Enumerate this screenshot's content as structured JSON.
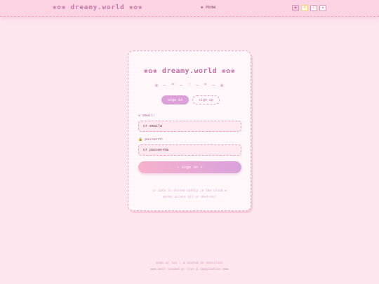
{
  "header": {
    "brand": "❀✿❀ dreamy.world ❀✿❀",
    "nav_home": "❀ Home",
    "theme_buttons": [
      "◆",
      "☀",
      "☾",
      "★"
    ]
  },
  "card": {
    "title": "❀✿❀ dreamy.world ❀✿❀",
    "divider": "❀ ~ * ~ ♡ ~ * ~ ❀",
    "tabs": {
      "signin": "sign in",
      "signup": "sign up"
    },
    "email_label": "✉ email:",
    "email_placeholder": "ur email✿",
    "password_label": "🔒 password:",
    "password_placeholder": "ur password✿",
    "submit_label": "✧ sign in ✧",
    "note_line1": "ur data is stored safely in the cloud ❀",
    "note_line2": "works across all ur devices!"
  },
  "footer": {
    "made_with": "made w/ luv",
    "hosted": "❀ hosted on neocities",
    "tagline": "❀❀❀ best viewed w/ love & imagination ❀❀❀"
  },
  "colors": {
    "background": "#fde6ee",
    "accent": "#dba0d8",
    "brand": "#c873a6"
  }
}
